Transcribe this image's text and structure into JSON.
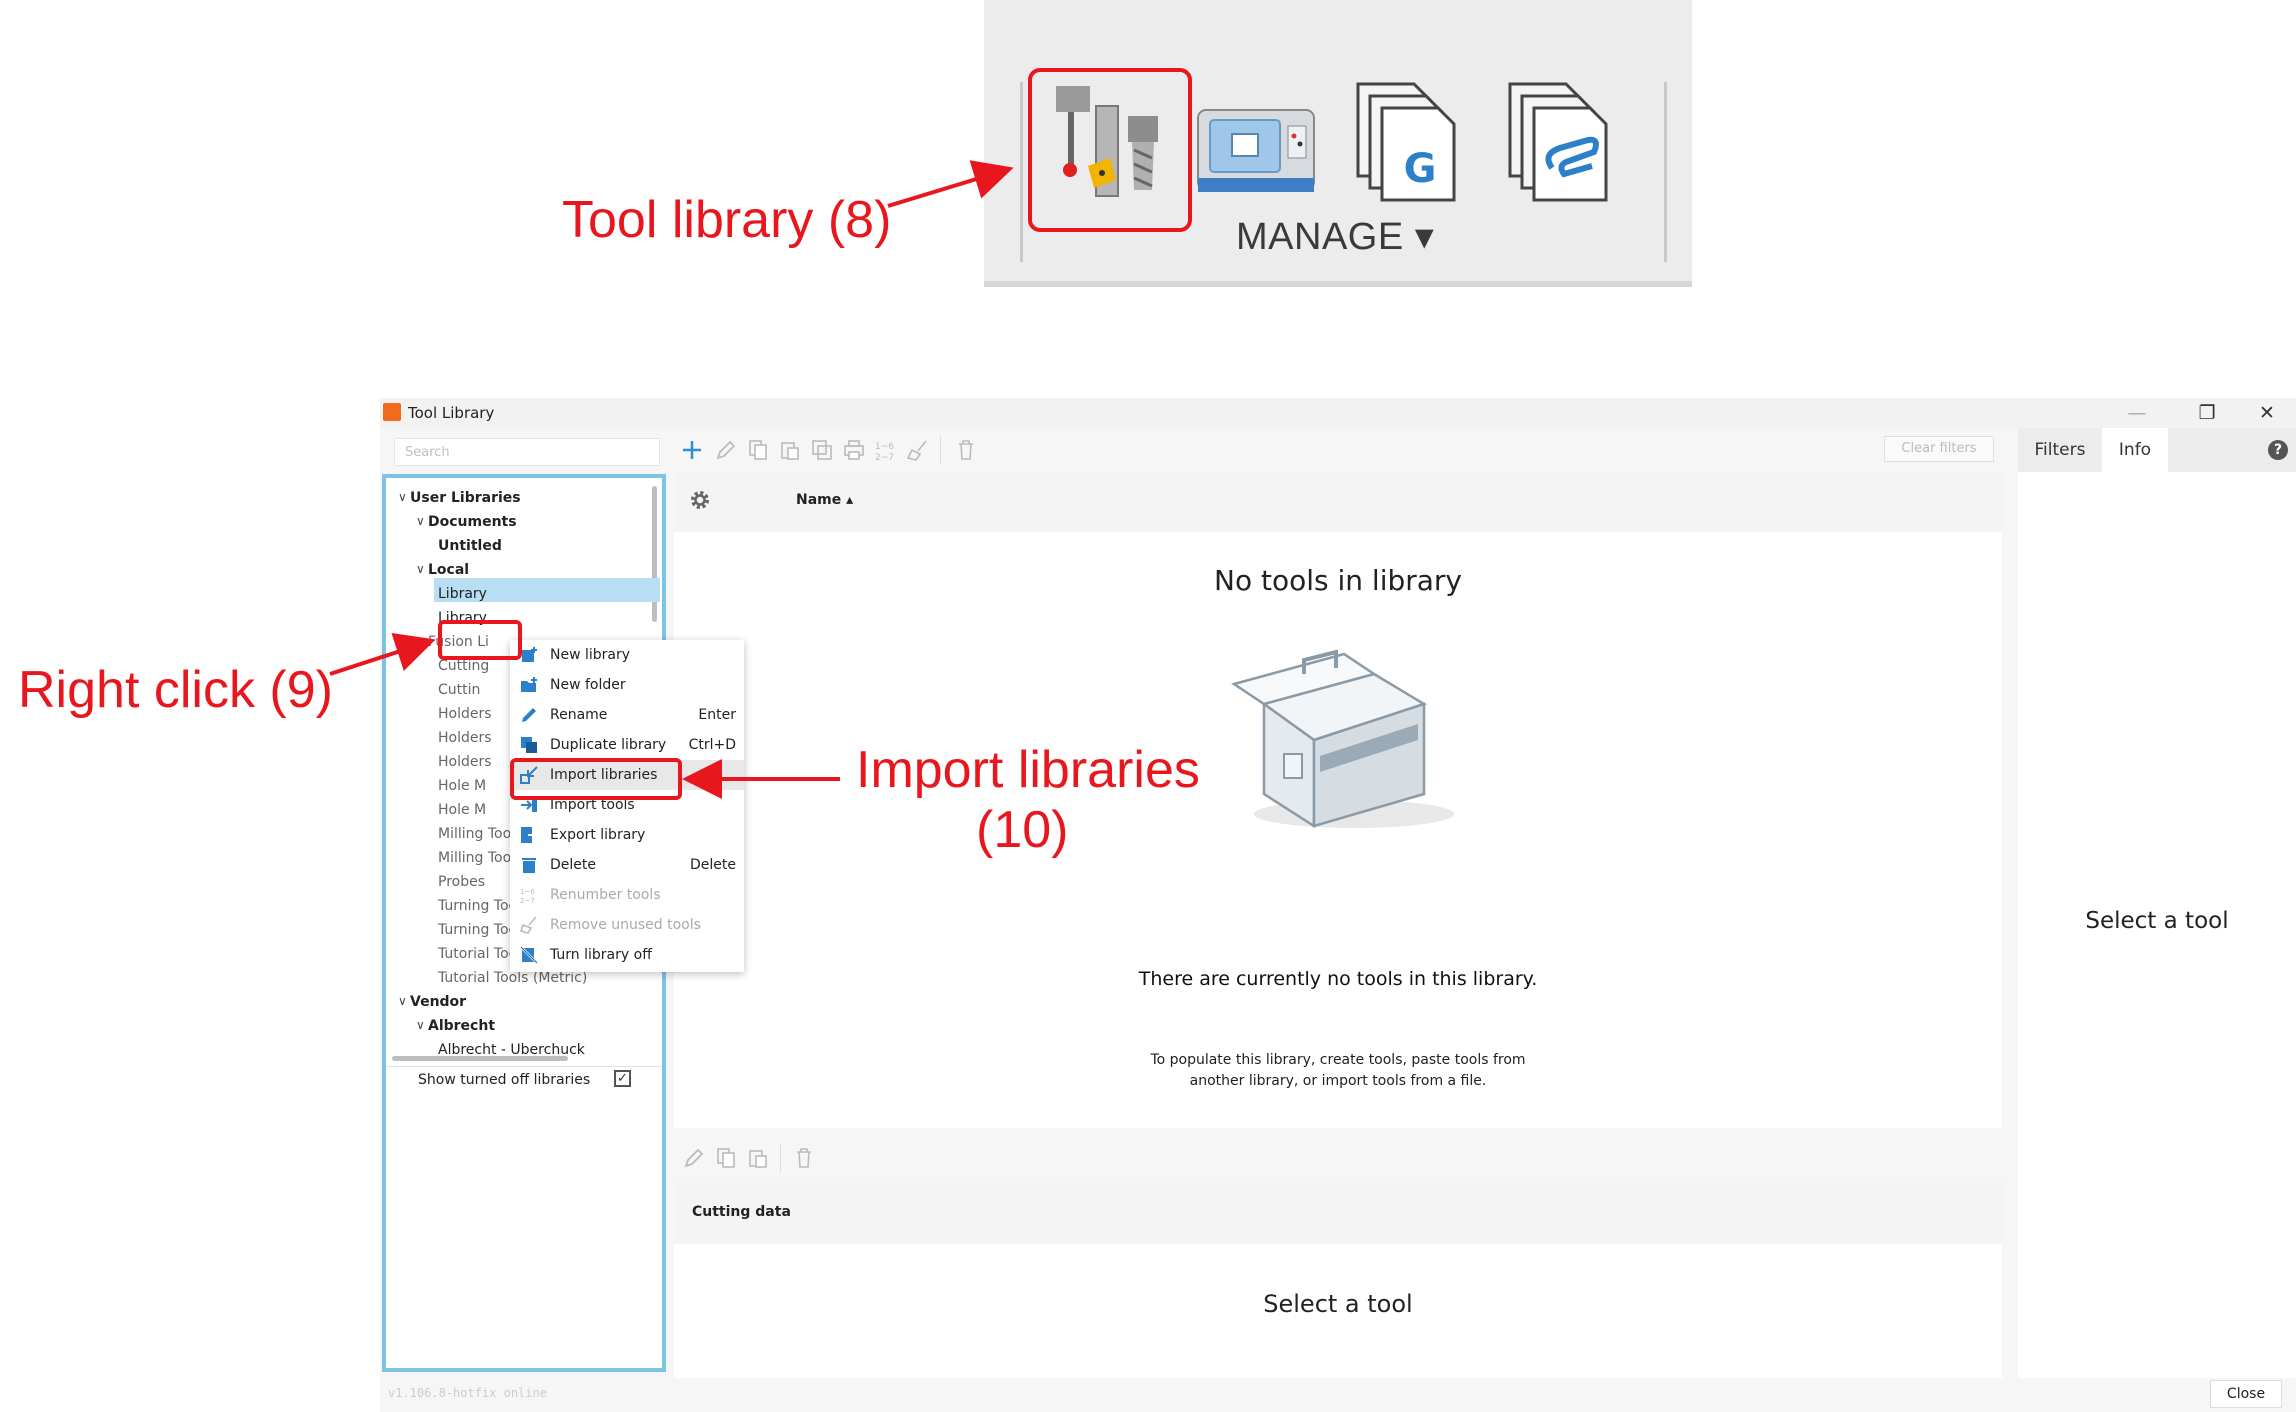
{
  "ribbon": {
    "manage_label": "MANAGE ▾"
  },
  "annotations": {
    "tool_library": "Tool library (8)",
    "right_click": "Right click (9)",
    "import_libraries_1": "Import libraries",
    "import_libraries_2": "(10)",
    "color": "#e8171d"
  },
  "window": {
    "title": "Tool Library",
    "search_placeholder": "Search",
    "clear_filters": "Clear filters",
    "version": "v1.106.8-hotfix online",
    "close_label": "Close",
    "accent": "#7cc3e4"
  },
  "tree": {
    "user_libraries": "User Libraries",
    "documents": "Documents",
    "untitled": "Untitled",
    "local": "Local",
    "library_selected": "Library",
    "library_2": "Library",
    "fusion": "Fusion Li",
    "fusion_items": [
      "Cutting",
      "Cuttin",
      "Holders",
      "Holders",
      "Holders",
      "Hole M",
      "Hole M",
      "Milling Tools (Inch)",
      "Milling Tools (Metric)",
      "Probes",
      "Turning Tools (Inch)",
      "Turning Tools (Metric)",
      "Tutorial Tools (Inch)",
      "Tutorial Tools (Metric)"
    ],
    "vendor": "Vendor",
    "albrecht": "Albrecht",
    "albrecht_item": "Albrecht - Uberchuck",
    "show_turned_off": "Show turned off libraries"
  },
  "context_menu": [
    {
      "label": "New library",
      "shortcut": "",
      "disabled": false,
      "icon": "new-library-icon"
    },
    {
      "label": "New folder",
      "shortcut": "",
      "disabled": false,
      "icon": "new-folder-icon"
    },
    {
      "label": "Rename",
      "shortcut": "Enter",
      "disabled": false,
      "icon": "pencil-icon"
    },
    {
      "label": "Duplicate library",
      "shortcut": "Ctrl+D",
      "disabled": false,
      "icon": "duplicate-icon"
    },
    {
      "label": "Import libraries",
      "shortcut": "",
      "disabled": false,
      "icon": "import-icon"
    },
    {
      "label": "Import tools",
      "shortcut": "",
      "disabled": false,
      "icon": "import-tools-icon"
    },
    {
      "label": "Export library",
      "shortcut": "",
      "disabled": false,
      "icon": "export-icon"
    },
    {
      "label": "Delete",
      "shortcut": "Delete",
      "disabled": false,
      "icon": "trash-icon"
    },
    {
      "label": "Renumber tools",
      "shortcut": "",
      "disabled": true,
      "icon": "renumber-icon"
    },
    {
      "label": "Remove unused tools",
      "shortcut": "",
      "disabled": true,
      "icon": "broom-icon"
    },
    {
      "label": "Turn library off",
      "shortcut": "",
      "disabled": false,
      "icon": "library-off-icon"
    }
  ],
  "main": {
    "col_name": "Name ▴",
    "no_tools_title": "No tools in library",
    "no_tools_desc": "There are currently no tools in this library.",
    "populate_1": "To populate this library, create tools, paste tools from",
    "populate_2": "another library, or import tools from a file.",
    "cutting_data": "Cutting data",
    "cut_select": "Select a tool"
  },
  "right_panel": {
    "tab_filters": "Filters",
    "tab_info": "Info",
    "select_tool": "Select a tool"
  }
}
